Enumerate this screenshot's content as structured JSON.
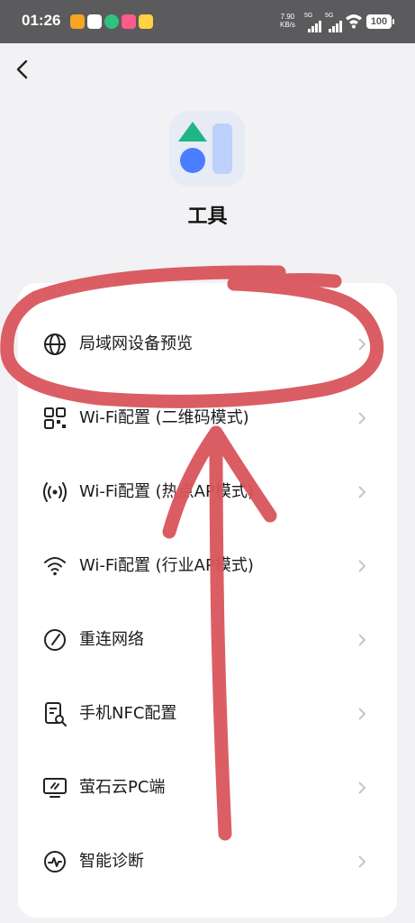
{
  "status_bar": {
    "time": "01:26",
    "net_speed_value": "7.90",
    "net_speed_unit": "KB/s",
    "signal1_label": "5G",
    "signal2_label": "5G",
    "battery": "100"
  },
  "header": {
    "title": "工具"
  },
  "menu": {
    "items": [
      {
        "label": "局域网设备预览",
        "icon": "globe-icon"
      },
      {
        "label": "Wi-Fi配置 (二维码模式)",
        "icon": "qr-code-icon"
      },
      {
        "label": "Wi-Fi配置 (热点AP模式)",
        "icon": "hotspot-icon"
      },
      {
        "label": "Wi-Fi配置 (行业AP模式)",
        "icon": "wifi-icon"
      },
      {
        "label": "重连网络",
        "icon": "reconnect-icon"
      },
      {
        "label": "手机NFC配置",
        "icon": "nfc-icon"
      },
      {
        "label": "萤石云PC端",
        "icon": "monitor-icon"
      },
      {
        "label": "智能诊断",
        "icon": "diagnosis-icon"
      }
    ]
  },
  "colors": {
    "annotation": "#d9555c",
    "background": "#f2f2f4",
    "card": "#ffffff",
    "icon_blue": "#4a7dff",
    "icon_green": "#1fb584"
  }
}
